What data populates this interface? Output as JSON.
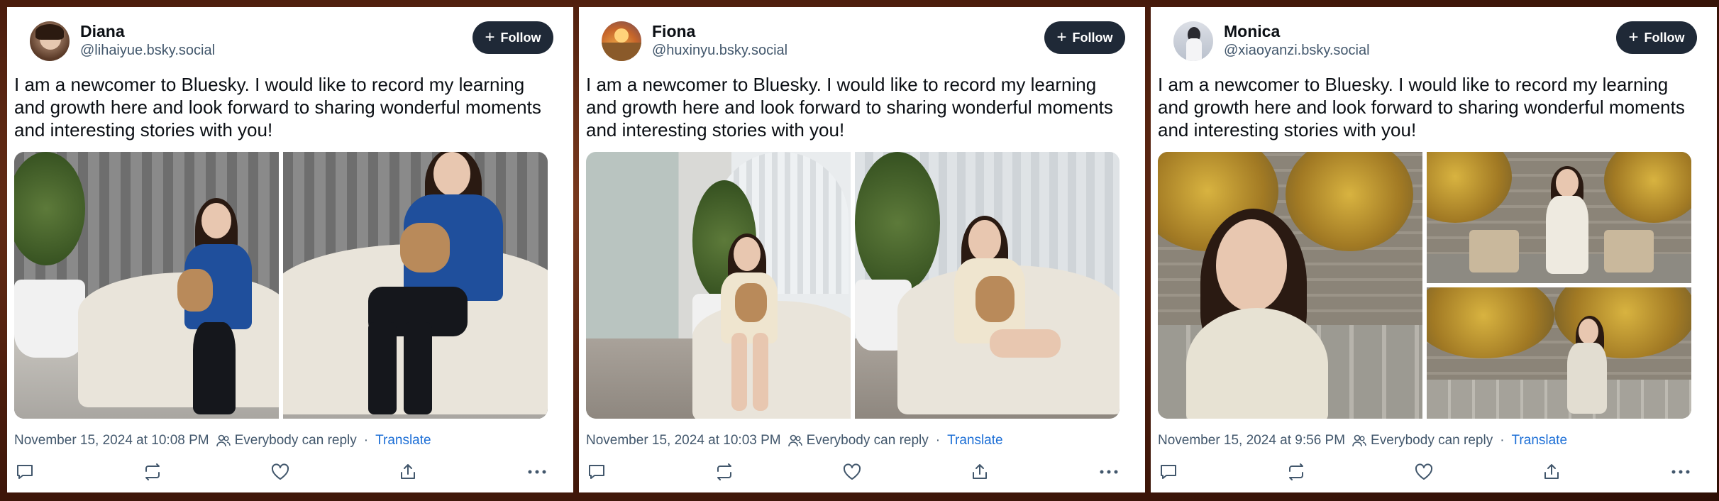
{
  "posts": [
    {
      "name": "Diana",
      "handle": "@lihaiyue.bsky.social",
      "follow_label": "Follow",
      "text": "I am a newcomer to Bluesky. I would like to record my learning and growth here and look forward to sharing wonderful moments and interesting stories with you!",
      "timestamp": "November 15, 2024 at 10:08 PM",
      "reply_setting": "Everybody can reply",
      "translate_label": "Translate",
      "image_count": 2
    },
    {
      "name": "Fiona",
      "handle": "@huxinyu.bsky.social",
      "follow_label": "Follow",
      "text": "I am a newcomer to Bluesky. I would like to record my learning and growth here and look forward to sharing wonderful moments and interesting stories with you!",
      "timestamp": "November 15, 2024 at 10:03 PM",
      "reply_setting": "Everybody can reply",
      "translate_label": "Translate",
      "image_count": 2
    },
    {
      "name": "Monica",
      "handle": "@xiaoyanzi.bsky.social",
      "follow_label": "Follow",
      "text": "I am a newcomer to Bluesky. I would like to record my learning and growth here and look forward to sharing wonderful moments and interesting stories with you!",
      "timestamp": "November 15, 2024 at 9:56 PM",
      "reply_setting": "Everybody can reply",
      "translate_label": "Translate",
      "image_count": 3
    }
  ],
  "separator": "·",
  "icons": [
    "plus-icon",
    "people-icon",
    "reply-icon",
    "repost-icon",
    "like-icon",
    "share-icon",
    "more-icon"
  ],
  "colors": {
    "follow_bg": "#1f2937",
    "link": "#1d6fd6",
    "muted": "#42576c",
    "text": "#0b0f14"
  }
}
